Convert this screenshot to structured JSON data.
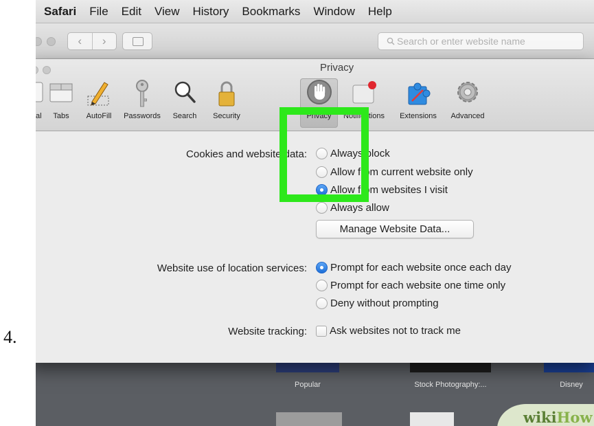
{
  "step": {
    "number": "4."
  },
  "menubar": {
    "app": "Safari",
    "items": [
      "File",
      "Edit",
      "View",
      "History",
      "Bookmarks",
      "Window",
      "Help"
    ]
  },
  "browser": {
    "back_glyph": "‹",
    "forward_glyph": "›",
    "address_placeholder": "Search or enter website name"
  },
  "prefs": {
    "title": "Privacy",
    "toolbar": [
      {
        "label": "ral",
        "icon": "general-icon"
      },
      {
        "label": "Tabs",
        "icon": "tabs-icon"
      },
      {
        "label": "AutoFill",
        "icon": "pencil-icon"
      },
      {
        "label": "Passwords",
        "icon": "key-icon"
      },
      {
        "label": "Search",
        "icon": "magnifier-icon"
      },
      {
        "label": "Security",
        "icon": "lock-icon"
      },
      {
        "label": "Privacy",
        "icon": "hand-icon",
        "selected": true
      },
      {
        "label": "Notifications",
        "icon": "notification-icon"
      },
      {
        "label": "Extensions",
        "icon": "puzzle-icon"
      },
      {
        "label": "Advanced",
        "icon": "gear-icon"
      }
    ],
    "cookies": {
      "label": "Cookies and website data:",
      "options": [
        "Always block",
        "Allow from current website only",
        "Allow from websites I visit",
        "Always allow"
      ],
      "selected": "Allow from websites I visit",
      "manage_button": "Manage Website Data..."
    },
    "location": {
      "label": "Website use of location services:",
      "options": [
        "Prompt for each website once each day",
        "Prompt for each website one time only",
        "Deny without prompting"
      ],
      "selected": "Prompt for each website once each day"
    },
    "tracking": {
      "label": "Website tracking:",
      "checkbox_label": "Ask websites not to track me",
      "checked": false
    },
    "help_glyph": "?"
  },
  "favorites": [
    "Popular",
    "Stock Photography:...",
    "Disney"
  ],
  "watermark": {
    "wiki": "wiki",
    "how": "How"
  },
  "colors": {
    "highlight": "#2de81b",
    "accent_blue": "#1d6fd8",
    "notification_dot": "#e0262e"
  }
}
